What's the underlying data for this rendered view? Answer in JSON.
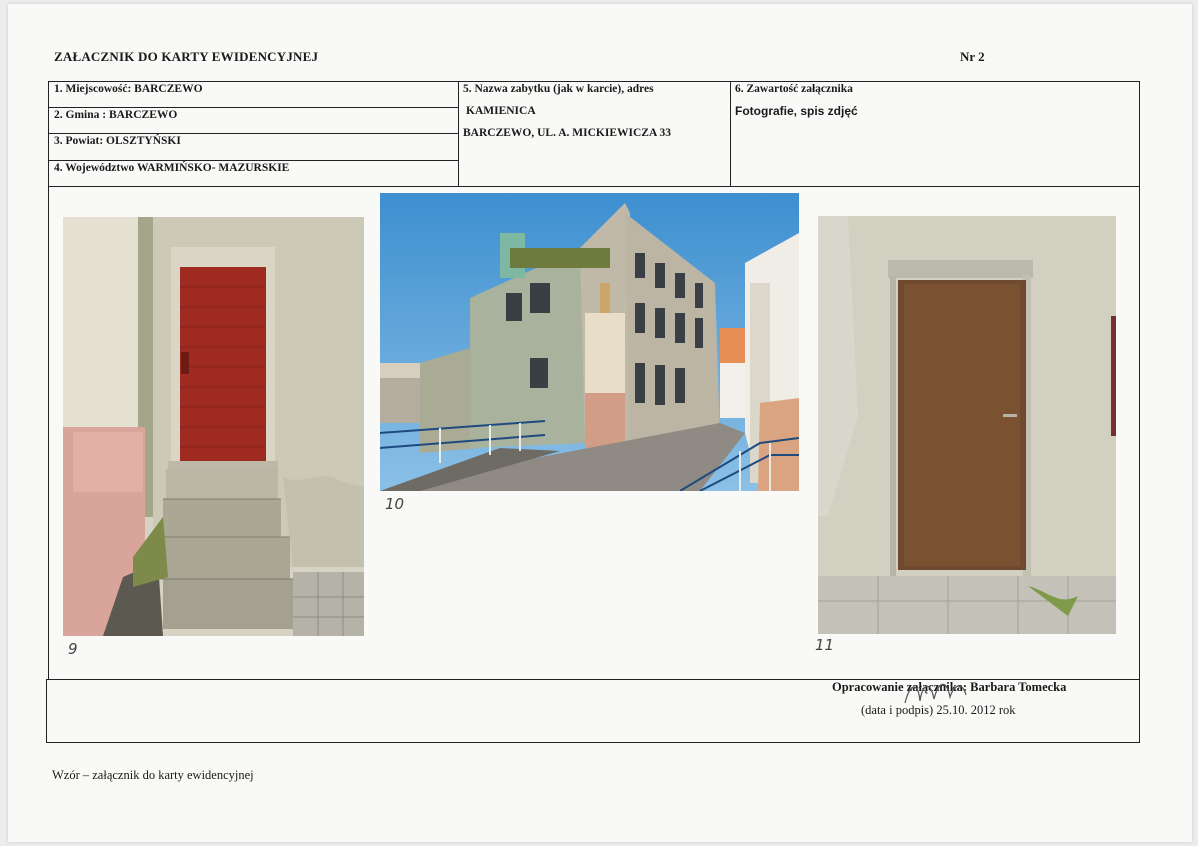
{
  "header": {
    "title": "ZAŁACZNIK DO KARTY EWIDENCYJNEJ",
    "number": "Nr 2"
  },
  "fields": {
    "f1": "1. Miejscowość: BARCZEWO",
    "f2": "2. Gmina : BARCZEWO",
    "f3": "3. Powiat: OLSZTYŃSKI",
    "f4": "4. Województwo WARMIŃSKO- MAZURSKIE",
    "f5_label": "5. Nazwa zabytku (jak w karcie), adres",
    "f5_name": "KAMIENICA",
    "f5_address": "BARCZEWO, UL. A.  MICKIEWICZA 33",
    "f6_label": "6. Zawartość załącznika",
    "f6_value": "Fotografie, spis zdjęć"
  },
  "photos": {
    "p9": "9",
    "p10": "10",
    "p11": "11"
  },
  "footer": {
    "prepared": "Opracowanie załącznika: Barbara Tomecka",
    "date": "(data i podpis) 25.10. 2012 rok",
    "bottom_note": "Wzór – załącznik do karty ewidencyjnej"
  }
}
